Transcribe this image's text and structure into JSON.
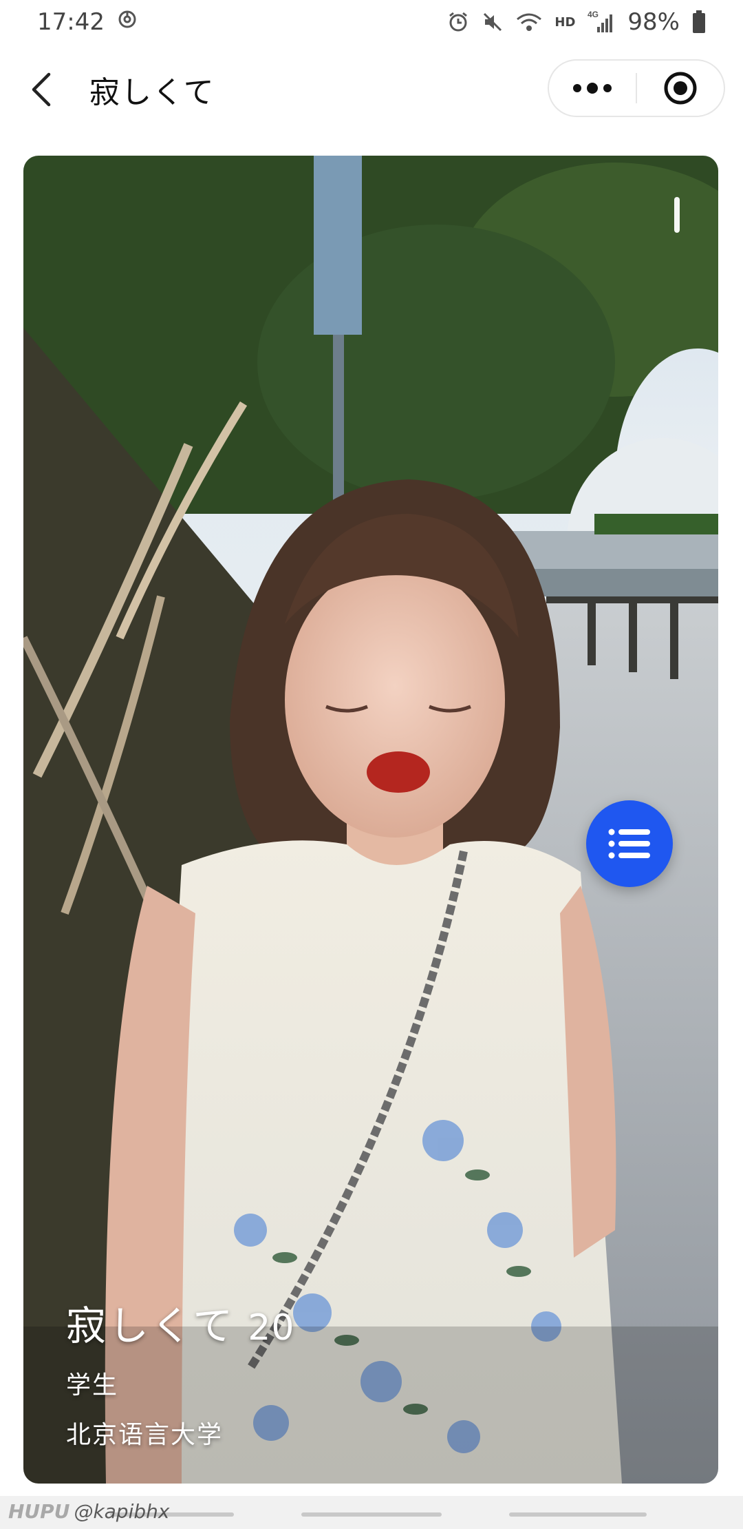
{
  "status_bar": {
    "time": "17:42",
    "battery": "98%",
    "network": "HD",
    "network_gen": "4G",
    "icons": [
      "sync-icon",
      "alarm-icon",
      "mute-icon",
      "wifi-icon",
      "signal-icon",
      "battery-icon"
    ]
  },
  "nav": {
    "title": "寂しくて",
    "back_icon": "chevron-left-icon",
    "more_icon": "more-dots-icon",
    "close_icon": "target-close-icon"
  },
  "profile": {
    "name": "寂しくて",
    "age": "20",
    "occupation": "学生",
    "school": "北京语言大学"
  },
  "menu_button": {
    "icon": "list-menu-icon",
    "color": "#1f57f0"
  },
  "watermark": {
    "brand": "HUPU",
    "handle": "@kapibhx"
  }
}
